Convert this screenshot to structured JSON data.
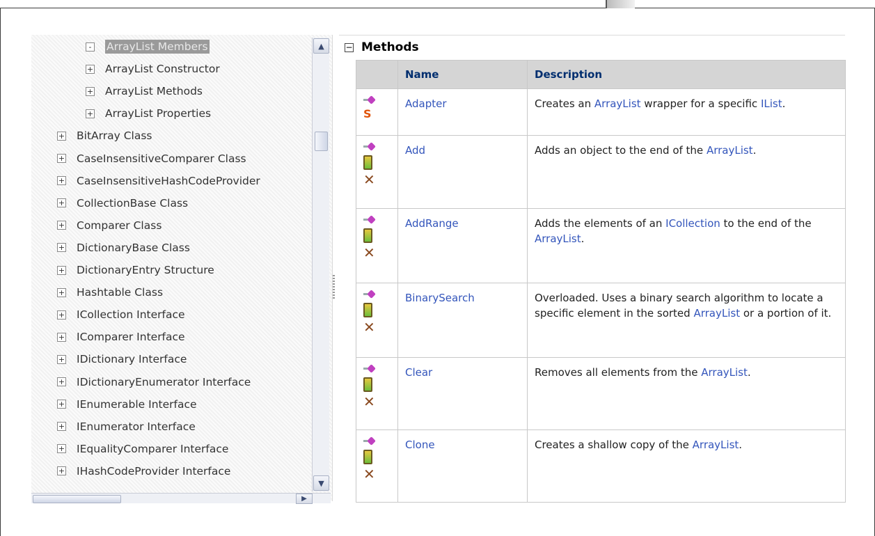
{
  "tree": {
    "items": [
      {
        "label": "ArrayList Members",
        "indent": 2,
        "expander": "-",
        "selected": true
      },
      {
        "label": "ArrayList Constructor",
        "indent": 2,
        "expander": "+"
      },
      {
        "label": "ArrayList Methods",
        "indent": 2,
        "expander": "+"
      },
      {
        "label": "ArrayList Properties",
        "indent": 2,
        "expander": "+"
      },
      {
        "label": "BitArray Class",
        "indent": 1,
        "expander": "+"
      },
      {
        "label": "CaseInsensitiveComparer Class",
        "indent": 1,
        "expander": "+"
      },
      {
        "label": "CaseInsensitiveHashCodeProvider",
        "indent": 1,
        "expander": "+"
      },
      {
        "label": "CollectionBase Class",
        "indent": 1,
        "expander": "+"
      },
      {
        "label": "Comparer Class",
        "indent": 1,
        "expander": "+"
      },
      {
        "label": "DictionaryBase Class",
        "indent": 1,
        "expander": "+"
      },
      {
        "label": "DictionaryEntry Structure",
        "indent": 1,
        "expander": "+"
      },
      {
        "label": "Hashtable Class",
        "indent": 1,
        "expander": "+"
      },
      {
        "label": "ICollection Interface",
        "indent": 1,
        "expander": "+"
      },
      {
        "label": "IComparer Interface",
        "indent": 1,
        "expander": "+"
      },
      {
        "label": "IDictionary Interface",
        "indent": 1,
        "expander": "+"
      },
      {
        "label": "IDictionaryEnumerator Interface",
        "indent": 1,
        "expander": "+"
      },
      {
        "label": "IEnumerable Interface",
        "indent": 1,
        "expander": "+"
      },
      {
        "label": "IEnumerator Interface",
        "indent": 1,
        "expander": "+"
      },
      {
        "label": "IEqualityComparer Interface",
        "indent": 1,
        "expander": "+"
      },
      {
        "label": "IHashCodeProvider Interface",
        "indent": 1,
        "expander": "+"
      }
    ]
  },
  "scroll": {
    "up": "▲",
    "down": "▼",
    "right": "▶"
  },
  "section": {
    "collapse_symbol": "−",
    "title": "Methods"
  },
  "table": {
    "headers": {
      "icons": "",
      "name": "Name",
      "description": "Description"
    },
    "rows": [
      {
        "name": "Adapter",
        "icons": [
          "public-method-icon",
          "static-icon"
        ],
        "desc": [
          {
            "t": "Creates an "
          },
          {
            "t": "ArrayList",
            "link": true
          },
          {
            "t": " wrapper for a specific "
          },
          {
            "t": "IList",
            "link": true
          },
          {
            "t": "."
          }
        ]
      },
      {
        "name": "Add",
        "icons": [
          "public-method-icon",
          "compact-framework-icon",
          "xna-framework-icon"
        ],
        "desc": [
          {
            "t": "Adds an object to the end of the "
          },
          {
            "t": "ArrayList",
            "link": true
          },
          {
            "t": "."
          }
        ]
      },
      {
        "name": "AddRange",
        "icons": [
          "public-method-icon",
          "compact-framework-icon",
          "xna-framework-icon"
        ],
        "desc": [
          {
            "t": "Adds the elements of an "
          },
          {
            "t": "ICollection",
            "link": true
          },
          {
            "t": " to the end of the "
          },
          {
            "t": "ArrayList",
            "link": true
          },
          {
            "t": "."
          }
        ]
      },
      {
        "name": "BinarySearch",
        "icons": [
          "public-method-icon",
          "compact-framework-icon",
          "xna-framework-icon"
        ],
        "desc": [
          {
            "t": "Overloaded. Uses a binary search algorithm to locate a specific element in the sorted "
          },
          {
            "t": "ArrayList",
            "link": true
          },
          {
            "t": " or a portion of it."
          }
        ]
      },
      {
        "name": "Clear",
        "icons": [
          "public-method-icon",
          "compact-framework-icon",
          "xna-framework-icon"
        ],
        "desc": [
          {
            "t": "Removes all elements from the "
          },
          {
            "t": "ArrayList",
            "link": true
          },
          {
            "t": "."
          }
        ]
      },
      {
        "name": "Clone",
        "icons": [
          "public-method-icon",
          "compact-framework-icon",
          "xna-framework-icon"
        ],
        "desc": [
          {
            "t": "Creates a shallow copy of the "
          },
          {
            "t": "ArrayList",
            "link": true
          },
          {
            "t": "."
          }
        ]
      }
    ]
  }
}
